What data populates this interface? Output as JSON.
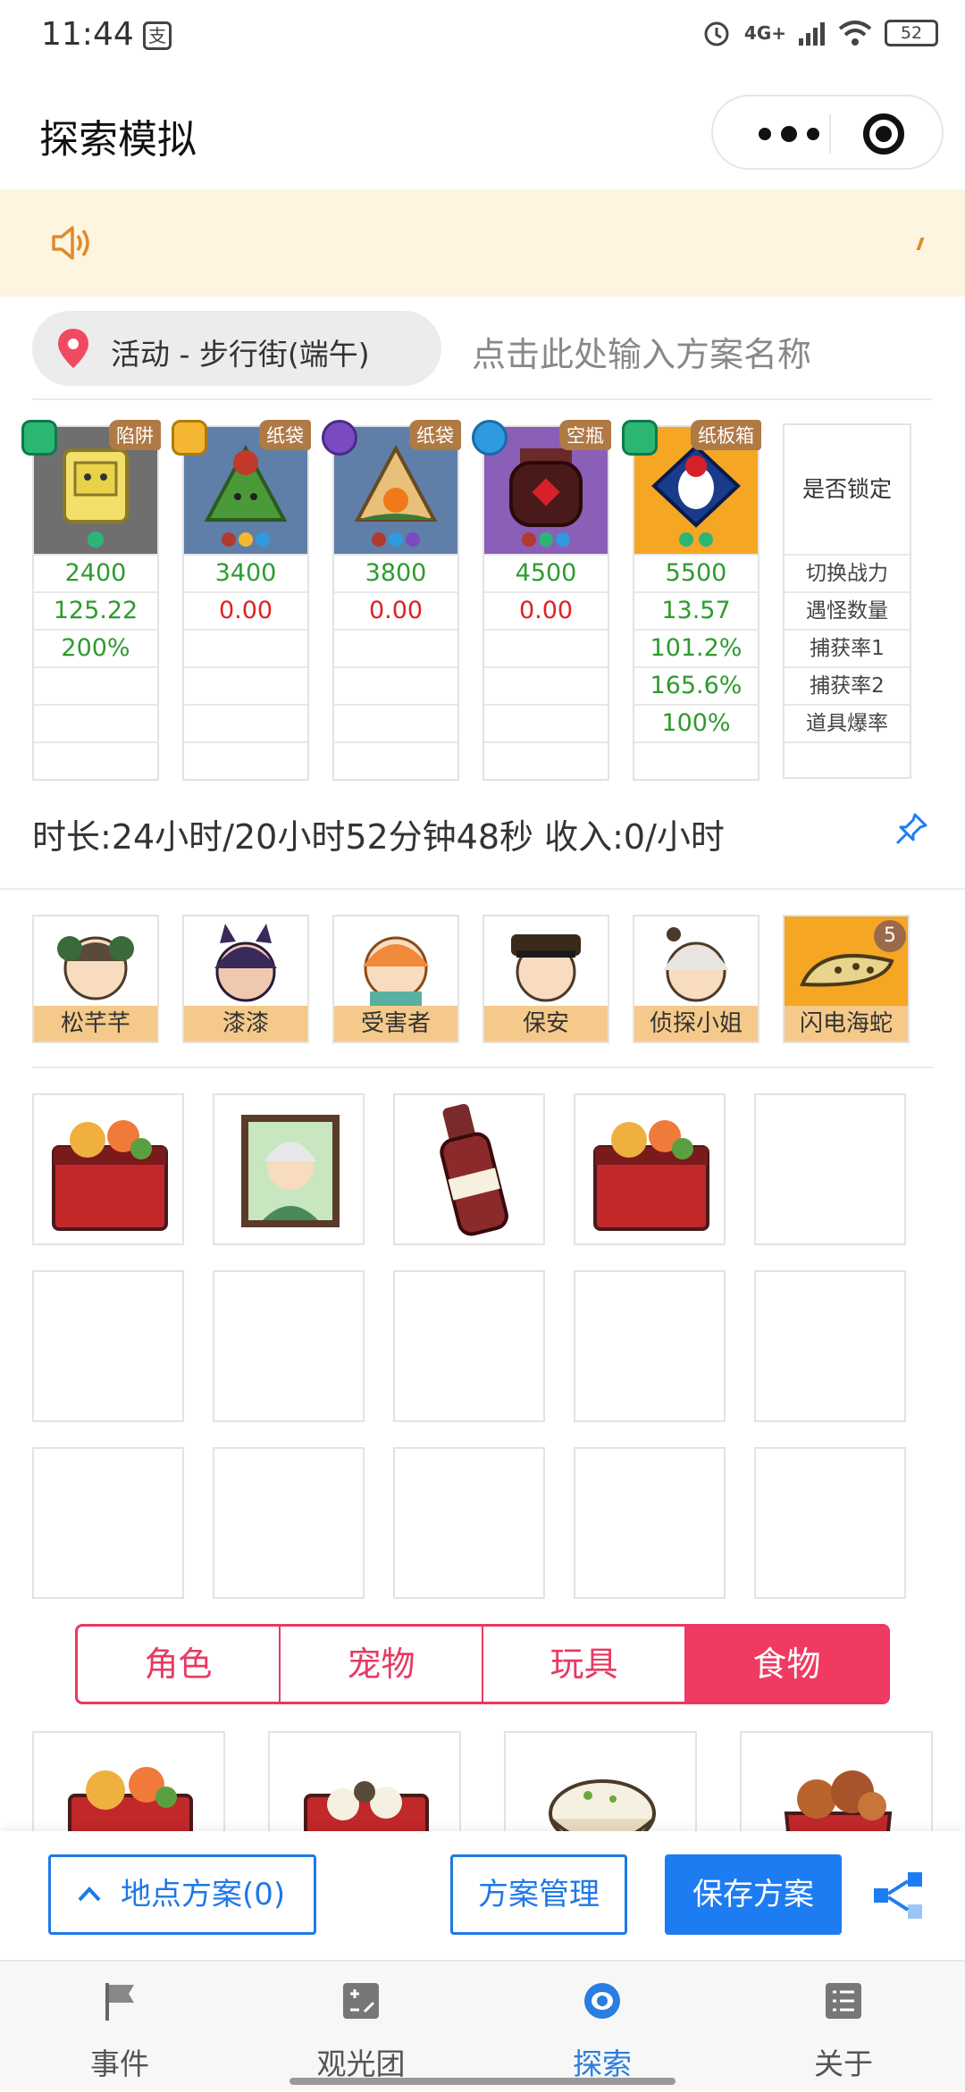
{
  "status_bar": {
    "time": "11:44",
    "app_icon": "支",
    "network": "4G+",
    "battery": "52"
  },
  "header": {
    "title": "探索模拟"
  },
  "location": {
    "label": "活动 - 步行街(端午)",
    "plan_name_placeholder": "点击此处输入方案名称"
  },
  "characters": [
    {
      "badge": "陷阱",
      "power": "2400",
      "stat": "125.22",
      "extra": "200%",
      "bg": "#6f6f6f"
    },
    {
      "badge": "纸袋",
      "power": "3400",
      "stat": "0.00",
      "extra": "",
      "bg": "#5f7fa8"
    },
    {
      "badge": "纸袋",
      "power": "3800",
      "stat": "0.00",
      "extra": "",
      "bg": "#5f7fa8"
    },
    {
      "badge": "空瓶",
      "power": "4500",
      "stat": "0.00",
      "extra": "",
      "bg": "#8a5fb8"
    },
    {
      "badge": "纸板箱",
      "power": "5500",
      "stat": "13.57",
      "extra": "101.2%",
      "extra2": "165.6%",
      "extra3": "100%",
      "bg": "#f5a623"
    }
  ],
  "lock_column": {
    "header": "是否锁定",
    "rows": [
      "切换战力",
      "遇怪数量",
      "捕获率1",
      "捕获率2",
      "道具爆率"
    ]
  },
  "duration_text": "时长:24小时/20小时52分钟48秒 收入:0/小时",
  "guides": [
    {
      "name": "松芊芊"
    },
    {
      "name": "漆漆"
    },
    {
      "name": "受害者"
    },
    {
      "name": "保安"
    },
    {
      "name": "侦探小姐"
    },
    {
      "name": "闪电海蛇",
      "count": "5"
    }
  ],
  "category_tabs": [
    {
      "label": "角色"
    },
    {
      "label": "宠物"
    },
    {
      "label": "玩具"
    },
    {
      "label": "食物"
    }
  ],
  "actions": {
    "location_plan": "地点方案(0)",
    "manage": "方案管理",
    "save": "保存方案"
  },
  "tabbar": [
    {
      "label": "事件"
    },
    {
      "label": "观光团"
    },
    {
      "label": "探索"
    },
    {
      "label": "关于"
    }
  ],
  "colors": {
    "accent_pink": "#f03a62",
    "accent_blue": "#1e7cf2",
    "stat_green": "#2e9b2e",
    "stat_red": "#dd2222"
  }
}
